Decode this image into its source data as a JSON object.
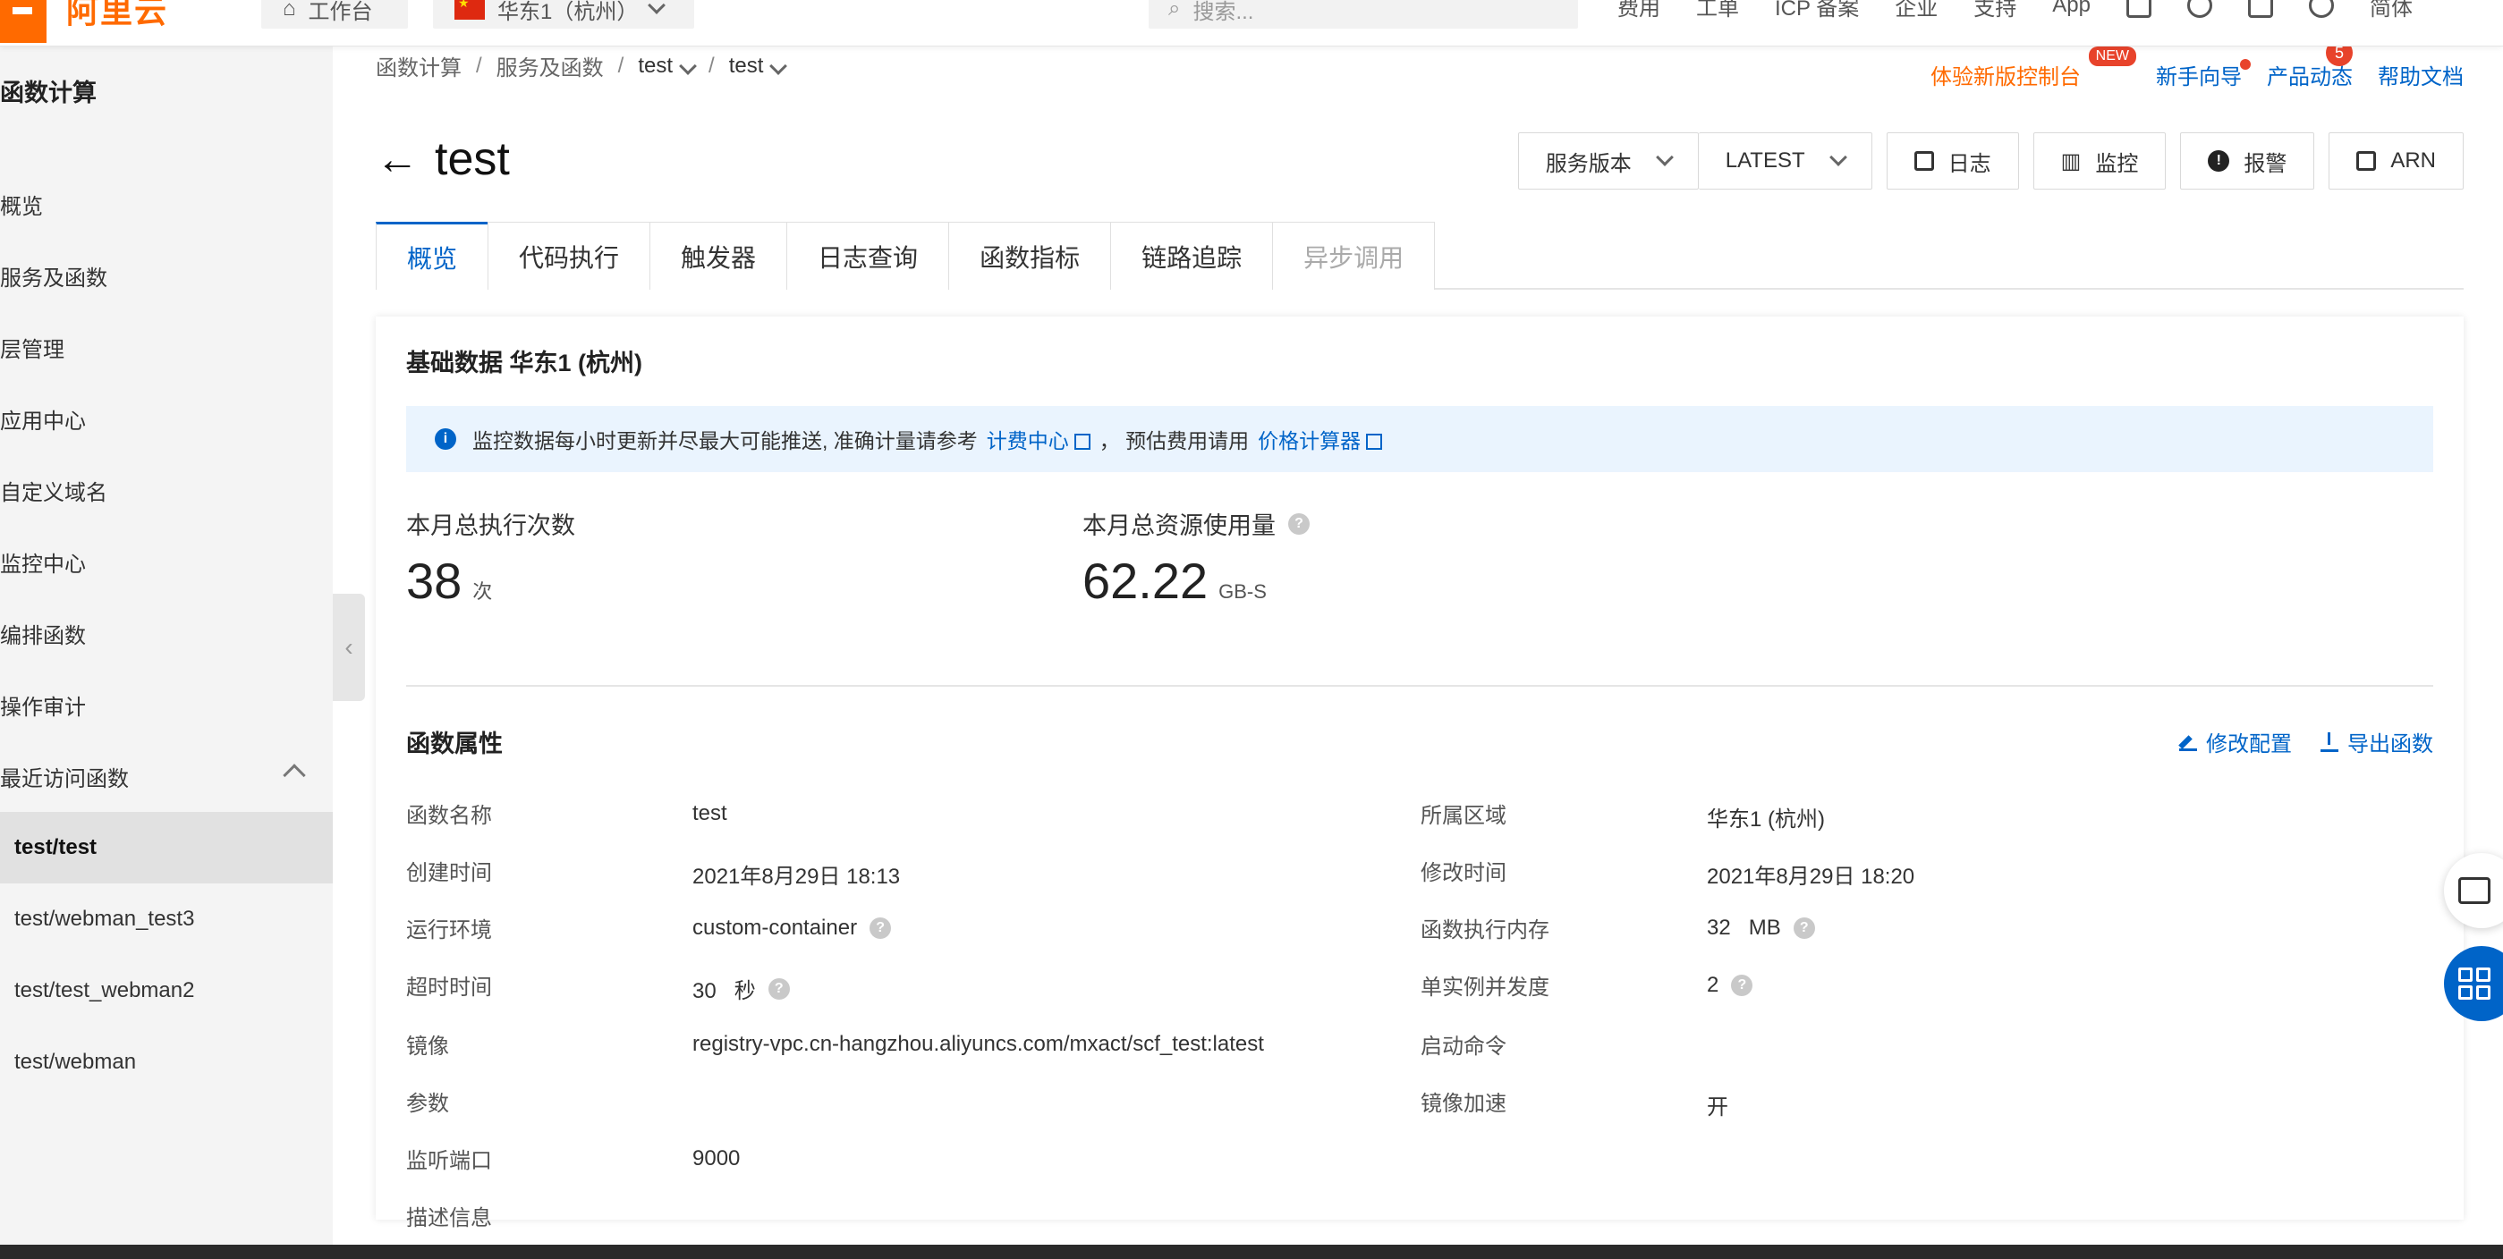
{
  "topbar": {
    "logo_text": "阿里云",
    "workbench": "工作台",
    "region": "华东1（杭州）",
    "search_placeholder": "搜索...",
    "links": [
      "费用",
      "工单",
      "ICP 备案",
      "企业",
      "支持",
      "App"
    ],
    "lang": "简体"
  },
  "sidebar": {
    "title": "函数计算",
    "items": [
      "概览",
      "服务及函数",
      "层管理",
      "应用中心",
      "自定义域名",
      "监控中心",
      "编排函数",
      "操作审计",
      "最近访问函数"
    ],
    "recent": [
      "test/test",
      "test/webman_test3",
      "test/test_webman2",
      "test/webman"
    ]
  },
  "breadcrumb": {
    "root": "函数计算",
    "services": "服务及函数",
    "service": "test",
    "function": "test"
  },
  "top_right": {
    "try_new": "体验新版控制台",
    "new_badge": "NEW",
    "guide": "新手向导",
    "news": "产品动态",
    "news_count": "5",
    "help": "帮助文档"
  },
  "page": {
    "title": "test",
    "version_label": "服务版本",
    "version_value": "LATEST",
    "log_btn": "日志",
    "monitor_btn": "监控",
    "alarm_btn": "报警",
    "arn_btn": "ARN"
  },
  "tabs": [
    "概览",
    "代码执行",
    "触发器",
    "日志查询",
    "函数指标",
    "链路追踪",
    "异步调用"
  ],
  "overview": {
    "title": "基础数据 华东1 (杭州)",
    "info_text": "监控数据每小时更新并尽最大可能推送, 准确计量请参考",
    "billing_link": "计费中心",
    "info_text2": "， 预估费用请用",
    "calc_link": "价格计算器",
    "exec_label": "本月总执行次数",
    "exec_value": "38",
    "exec_unit": "次",
    "usage_label": "本月总资源使用量",
    "usage_value": "62.22",
    "usage_unit": "GB-S"
  },
  "props": {
    "title": "函数属性",
    "edit": "修改配置",
    "export": "导出函数",
    "left": [
      {
        "label": "函数名称",
        "value": "test"
      },
      {
        "label": "创建时间",
        "value": "2021年8月29日 18:13"
      },
      {
        "label": "运行环境",
        "value": "custom-container"
      },
      {
        "label": "超时时间",
        "value": "30   秒"
      },
      {
        "label": "镜像",
        "value": "registry-vpc.cn-hangzhou.aliyuncs.com/mxact/scf_test:latest"
      },
      {
        "label": "参数",
        "value": ""
      },
      {
        "label": "监听端口",
        "value": "9000"
      },
      {
        "label": "描述信息",
        "value": ""
      }
    ],
    "right": [
      {
        "label": "所属区域",
        "value": "华东1 (杭州)"
      },
      {
        "label": "修改时间",
        "value": "2021年8月29日 18:20"
      },
      {
        "label": "函数执行内存",
        "value": "32   MB"
      },
      {
        "label": "单实例并发度",
        "value": "2"
      },
      {
        "label": "启动命令",
        "value": ""
      },
      {
        "label": "镜像加速",
        "value": "开"
      }
    ]
  }
}
